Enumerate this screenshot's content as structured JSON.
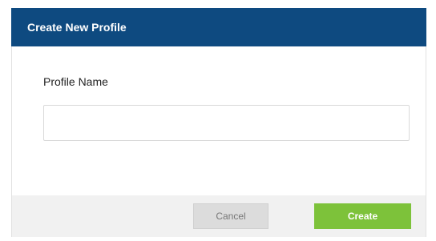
{
  "dialog": {
    "title": "Create New Profile",
    "profile_name_label": "Profile Name",
    "profile_name_value": "",
    "profile_name_placeholder": "",
    "cancel_label": "Cancel",
    "create_label": "Create"
  },
  "colors": {
    "header_background": "#0e4a80",
    "create_button": "#7dc23a",
    "cancel_button": "#dcdcdc",
    "footer_background": "#f1f1f1"
  }
}
